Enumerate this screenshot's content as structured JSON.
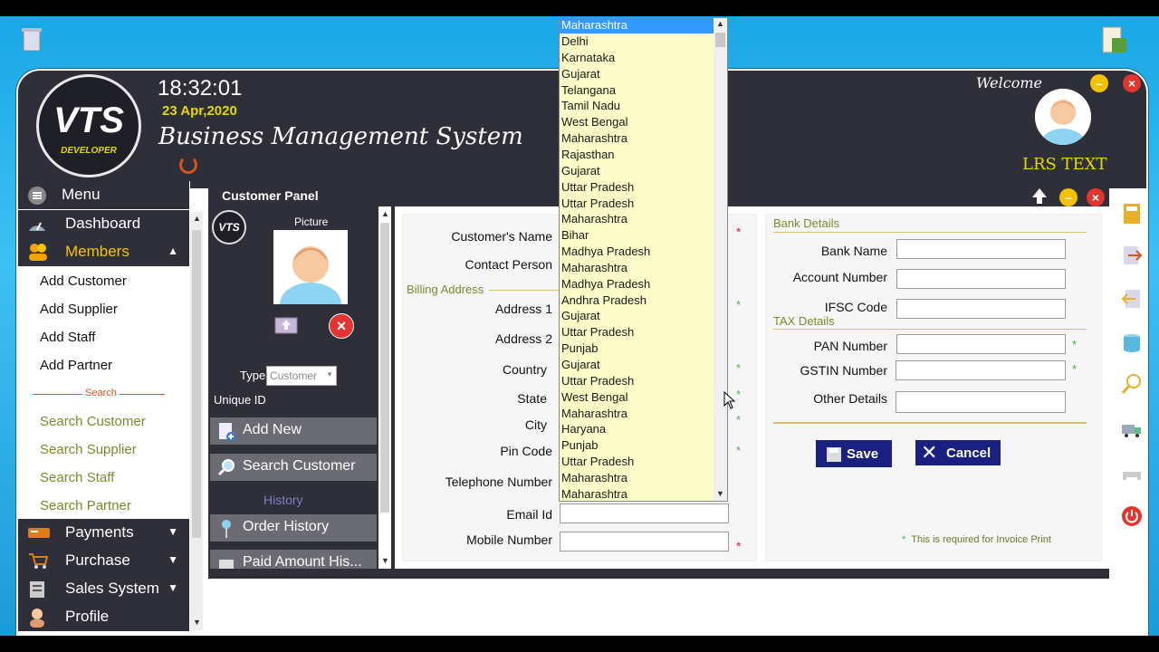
{
  "header": {
    "logo_text": "VTS",
    "logo_subtext": "DEVELOPER",
    "time": "18:32:01",
    "date": "23 Apr,2020",
    "title": "Business Management System",
    "welcome": "Welcome",
    "username": "LRS TEXT"
  },
  "sidebar": {
    "menu": "Menu",
    "dashboard": "Dashboard",
    "members": "Members",
    "members_items": [
      "Add Customer",
      "Add Supplier",
      "Add Staff",
      "Add Partner"
    ],
    "search_divider": "Search",
    "search_items": [
      "Search Customer",
      "Search Supplier",
      "Search Staff",
      "Search Partner"
    ],
    "payments": "Payments",
    "purchase": "Purchase",
    "sales": "Sales System",
    "profile": "Profile"
  },
  "panel": {
    "title": "Customer Panel",
    "logo_text": "VTS",
    "picture_label": "Picture",
    "type_label": "Type",
    "type_value": "Customer",
    "unique_id_label": "Unique ID",
    "add_new": "Add New",
    "search_customer": "Search Customer",
    "history_label": "History",
    "order_history": "Order History",
    "paid_amount_history": "Paid Amount His..."
  },
  "form": {
    "customer_name": "Customer's Name",
    "contact_person": "Contact Person",
    "billing_address": "Billing Address",
    "address1": "Address 1",
    "address2": "Address 2",
    "country": "Country",
    "state": "State",
    "city": "City",
    "pin_code": "Pin Code",
    "telephone": "Telephone Number",
    "email": "Email Id",
    "mobile": "Mobile Number",
    "bank_details": "Bank Details",
    "bank_name": "Bank Name",
    "account_number": "Account Number",
    "ifsc": "IFSC Code",
    "tax_details": "TAX Details",
    "pan": "PAN Number",
    "gstin": "GSTIN Number",
    "other_details": "Other Details",
    "save": "Save",
    "cancel": "Cancel",
    "invoice_note": "This is required for Invoice Print",
    "required_mark": "*"
  },
  "state_dropdown": {
    "selected": "Maharashtra",
    "options": [
      "Maharashtra",
      "Delhi",
      "Karnataka",
      "Gujarat",
      "Telangana",
      "Tamil Nadu",
      "West Bengal",
      "Maharashtra",
      "Rajasthan",
      "Gujarat",
      "Uttar Pradesh",
      "Uttar Pradesh",
      "Maharashtra",
      "Bihar",
      "Madhya Pradesh",
      "Maharashtra",
      "Madhya Pradesh",
      "Andhra Pradesh",
      "Gujarat",
      "Uttar Pradesh",
      "Punjab",
      "Gujarat",
      "Uttar Pradesh",
      "West Bengal",
      "Maharashtra",
      "Haryana",
      "Punjab",
      "Uttar Pradesh",
      "Maharashtra",
      "Maharashtra"
    ]
  },
  "colors": {
    "header_bg": "#2f2f3a",
    "accent_yellow": "#e3d800",
    "members_highlight": "#f5c400",
    "dropdown_bg": "#fbfcc7",
    "button_blue": "#1a2080",
    "required_red": "#d81b60"
  }
}
